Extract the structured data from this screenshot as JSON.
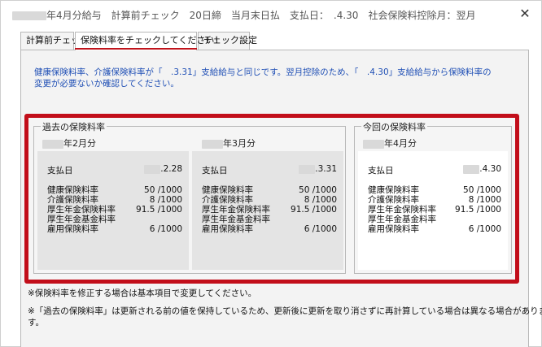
{
  "window": {
    "title": "年4月分給与　計算前チェック　20日締　当月末日払　支払日：　.4.30　社会保険料控除月：翌月",
    "close_glyph": "✕"
  },
  "tabs": [
    {
      "label": "計算前チェック"
    },
    {
      "label": "保険料率をチェックしてください！"
    },
    {
      "label": "チェック設定"
    }
  ],
  "notice": {
    "line1": "健康保険料率、介護保険料率が「　.3.31」支給給与と同じです。翌月控除のため、「　.4.30」支給給与から保険料率の",
    "line2": "変更が必要ないか確認してください。"
  },
  "past": {
    "group_label": "過去の保険料率",
    "months": [
      {
        "month": "年2月分",
        "pay_label": "支払日",
        "pay_value": ".2.28",
        "rates": [
          {
            "label": "健康保険料率",
            "value": "50 /1000"
          },
          {
            "label": "介護保険料率",
            "value": "8 /1000"
          },
          {
            "label": "厚生年金保険料率",
            "value": "91.5 /1000"
          },
          {
            "label": "厚生年金基金料率",
            "value": ""
          },
          {
            "label": "雇用保険料率",
            "value": "6 /1000"
          }
        ]
      },
      {
        "month": "年3月分",
        "pay_label": "支払日",
        "pay_value": ".3.31",
        "rates": [
          {
            "label": "健康保険料率",
            "value": "50 /1000"
          },
          {
            "label": "介護保険料率",
            "value": "8 /1000"
          },
          {
            "label": "厚生年金保険料率",
            "value": "91.5 /1000"
          },
          {
            "label": "厚生年金基金料率",
            "value": ""
          },
          {
            "label": "雇用保険料率",
            "value": "6 /1000"
          }
        ]
      }
    ]
  },
  "current": {
    "group_label": "今回の保険料率",
    "month": "年4月分",
    "pay_label": "支払日",
    "pay_value": ".4.30",
    "rates": [
      {
        "label": "健康保険料率",
        "value": "50 /1000"
      },
      {
        "label": "介護保険料率",
        "value": "8 /1000"
      },
      {
        "label": "厚生年金保険料率",
        "value": "91.5 /1000"
      },
      {
        "label": "厚生年金基金料率",
        "value": ""
      },
      {
        "label": "雇用保険料率",
        "value": "6 /1000"
      }
    ]
  },
  "notes": {
    "note1": "※保険料率を修正する場合は基本項目で変更してください。",
    "note2_line1": "※「過去の保険料率」は更新される前の値を保持しているため、更新後に更新を取り消さずに再計算している場合は異なる場合がありま",
    "note2_line2": "す。"
  },
  "colors": {
    "accent_red": "#c20e1a",
    "notice_blue": "#1f4fb5"
  }
}
